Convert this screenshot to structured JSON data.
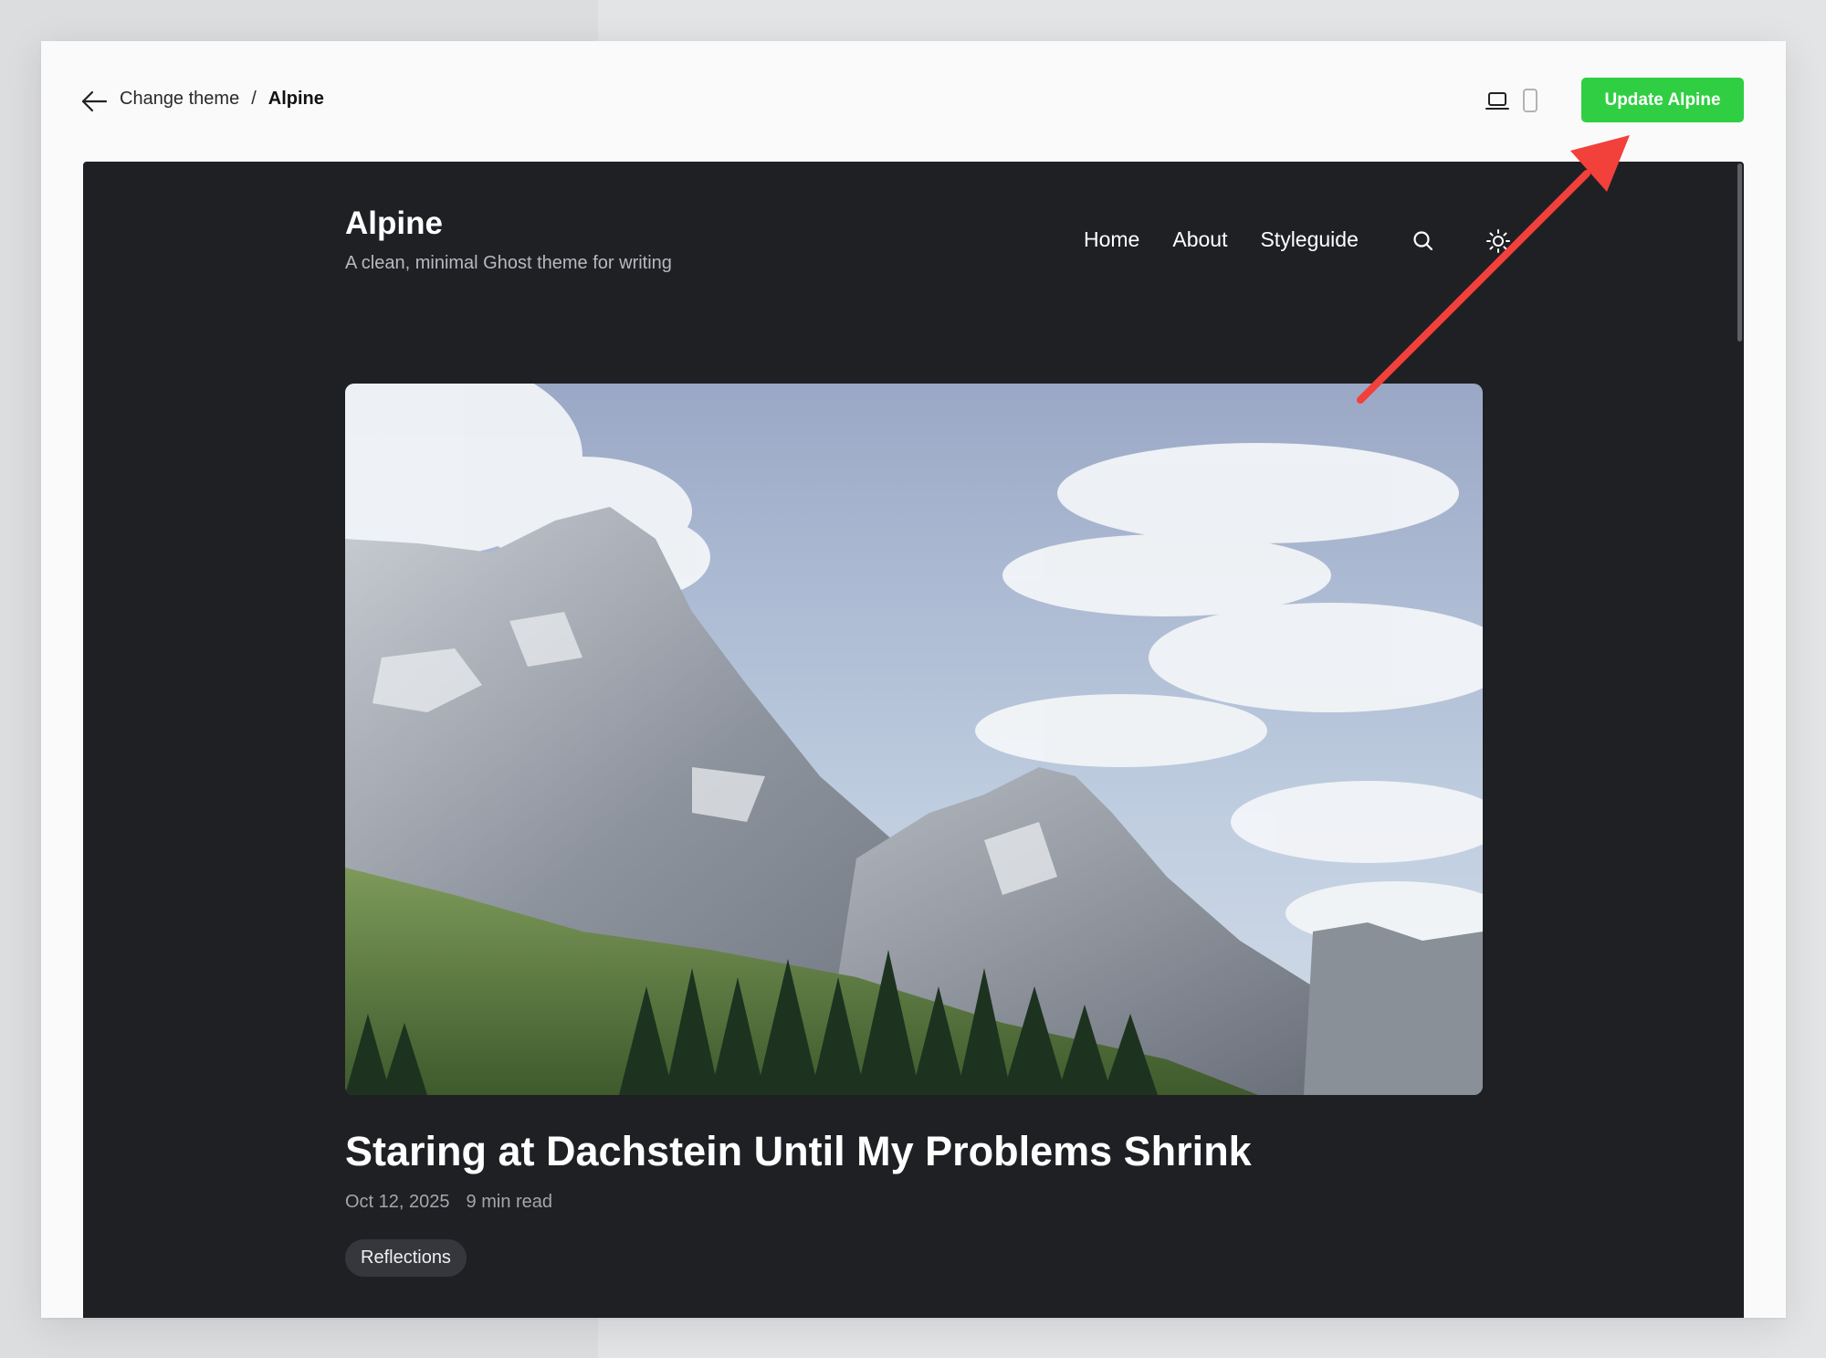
{
  "topbar": {
    "breadcrumb_parent": "Change theme",
    "breadcrumb_separator": "/",
    "breadcrumb_current": "Alpine",
    "update_button": "Update Alpine",
    "active_device": "desktop"
  },
  "preview": {
    "site_title": "Alpine",
    "site_tagline": "A clean, minimal Ghost theme for writing",
    "nav": [
      "Home",
      "About",
      "Styleguide"
    ],
    "post": {
      "title": "Staring at Dachstein Until My Problems Shrink",
      "date": "Oct 12, 2025",
      "read_time": "9 min read",
      "tag": "Reflections"
    }
  },
  "colors": {
    "accent": "#30cf43",
    "preview_bg": "#1f2024",
    "annotation_arrow": "#f2403a"
  },
  "icons": {
    "back": "arrow-left-icon",
    "desktop": "laptop-icon",
    "mobile": "mobile-phone-icon",
    "search": "search-icon",
    "theme_toggle": "sun-icon"
  }
}
